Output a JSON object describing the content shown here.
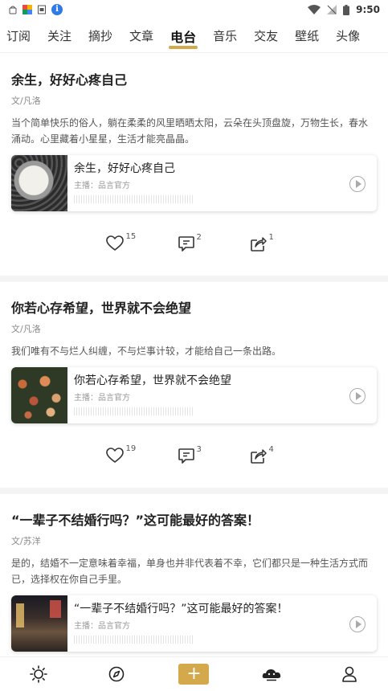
{
  "status_bar": {
    "time": "9:50",
    "info_glyph": "i",
    "icons": [
      "android-icon",
      "colorful-app-icon",
      "sim-icon",
      "info-icon",
      "wifi-icon",
      "no-signal-icon",
      "battery-icon"
    ]
  },
  "tabs": [
    {
      "label": "订阅"
    },
    {
      "label": "关注"
    },
    {
      "label": "摘抄"
    },
    {
      "label": "文章"
    },
    {
      "label": "电台"
    },
    {
      "label": "音乐"
    },
    {
      "label": "交友"
    },
    {
      "label": "壁纸"
    },
    {
      "label": "头像"
    }
  ],
  "accent_color": "#d4a94b",
  "posts": [
    {
      "title": "余生，好好心疼自己",
      "author": "文/凡洛",
      "excerpt": "当个简单快乐的俗人，躺在柔柔的风里晒晒太阳，云朵在头顶盘旋，万物生长，春水涌动。心里藏着小星星，生活才能亮晶晶。",
      "audio": {
        "title": "余生，好好心疼自己",
        "host": "主播：品言官方"
      },
      "likes": "15",
      "comments": "2",
      "shares": "1"
    },
    {
      "title": "你若心存希望，世界就不会绝望",
      "author": "文/凡洛",
      "excerpt": "我们唯有不与烂人纠缠，不与烂事计较，才能给自己一条出路。",
      "audio": {
        "title": "你若心存希望，世界就不会绝望",
        "host": "主播：品言官方"
      },
      "likes": "19",
      "comments": "3",
      "shares": "4"
    },
    {
      "title": "“一辈子不结婚行吗？”这可能最好的答案！",
      "author": "文/苏洋",
      "excerpt": "是的，结婚不一定意味着幸福，单身也并非代表着不幸，它们都只是一种生活方式而已，选择权在你自己手里。",
      "audio": {
        "title": "“一辈子不结婚行吗？”这可能最好的答案！",
        "host": "主播：品言官方"
      },
      "likes": "",
      "comments": "",
      "shares": ""
    }
  ],
  "bottom_nav": {
    "add_label": "+",
    "items": [
      "sun-icon",
      "compass-icon",
      "add-icon",
      "cloud-cat-icon",
      "user-icon"
    ]
  }
}
